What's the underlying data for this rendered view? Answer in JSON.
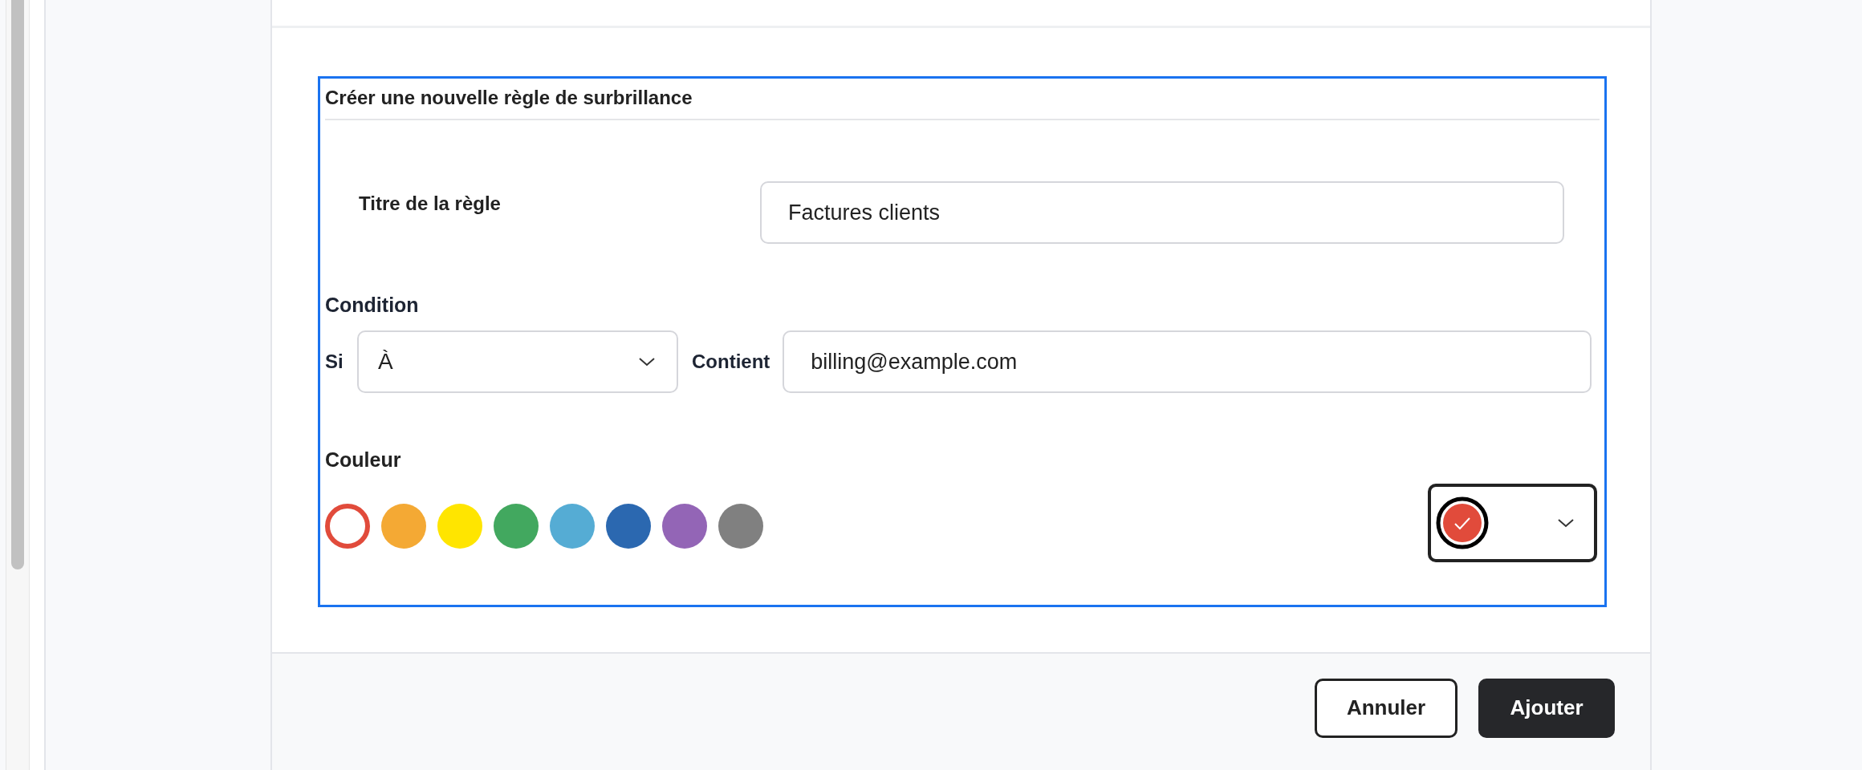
{
  "form": {
    "title": "Créer une nouvelle règle de surbrillance",
    "rule_title": {
      "label": "Titre de la règle",
      "value": "Factures clients"
    },
    "condition": {
      "heading": "Condition",
      "if_label": "Si",
      "field": "À",
      "operator_label": "Contient",
      "value": "billing@example.com"
    },
    "color": {
      "heading": "Couleur",
      "swatches": [
        {
          "color": "#e14b3b",
          "selected": true
        },
        {
          "color": "#f4a934",
          "selected": false
        },
        {
          "color": "#ffe500",
          "selected": false
        },
        {
          "color": "#42a85f",
          "selected": false
        },
        {
          "color": "#55acd4",
          "selected": false
        },
        {
          "color": "#2b68b0",
          "selected": false
        },
        {
          "color": "#9365b6",
          "selected": false
        },
        {
          "color": "#808080",
          "selected": false
        }
      ]
    }
  },
  "buttons": [
    {
      "label": "Annuler",
      "kind": "secondary"
    },
    {
      "label": "Ajouter",
      "kind": "primary"
    }
  ]
}
